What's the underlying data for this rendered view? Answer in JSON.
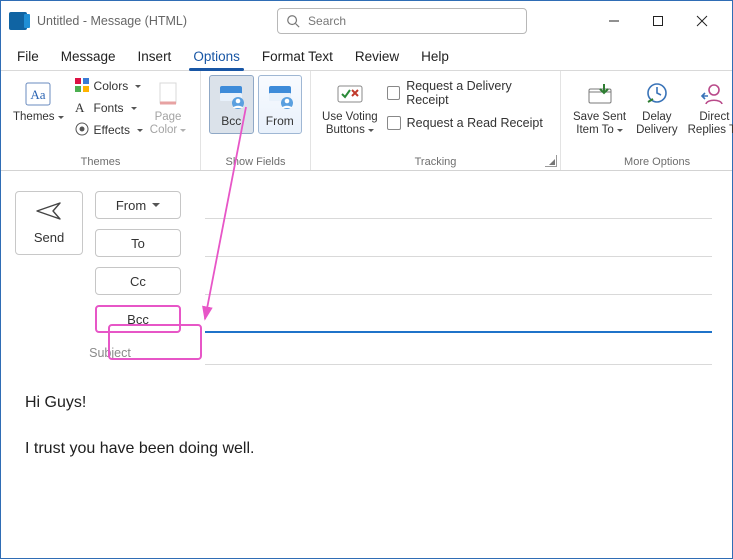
{
  "window": {
    "title": "Untitled  -  Message (HTML)"
  },
  "search": {
    "placeholder": "Search"
  },
  "wincontrols": {
    "min": "Minimize",
    "max": "Maximize",
    "close": "Close"
  },
  "menu": {
    "tabs": [
      "File",
      "Message",
      "Insert",
      "Options",
      "Format Text",
      "Review",
      "Help"
    ],
    "active_index": 3
  },
  "ribbon": {
    "themes_group": {
      "label": "Themes",
      "themes_btn": "Themes",
      "colors": "Colors",
      "fonts": "Fonts",
      "effects": "Effects",
      "page_color": "Page\nColor"
    },
    "showfields_group": {
      "label": "Show Fields",
      "bcc": "Bcc",
      "from": "From"
    },
    "tracking_group": {
      "label": "Tracking",
      "voting": "Use Voting\nButtons",
      "delivery_receipt": "Request a Delivery Receipt",
      "read_receipt": "Request a Read Receipt"
    },
    "moreoptions_group": {
      "label": "More Options",
      "save_sent": "Save Sent\nItem To",
      "delay": "Delay\nDelivery",
      "direct": "Direct\nReplies To"
    }
  },
  "compose": {
    "send": "Send",
    "from": "From",
    "to": "To",
    "cc": "Cc",
    "bcc": "Bcc",
    "subject_label": "Subject",
    "body_line1": "Hi Guys!",
    "body_line2": "I trust you have been doing well."
  },
  "colors": {
    "accent": "#1856a5",
    "annotation": "#e756c7"
  }
}
